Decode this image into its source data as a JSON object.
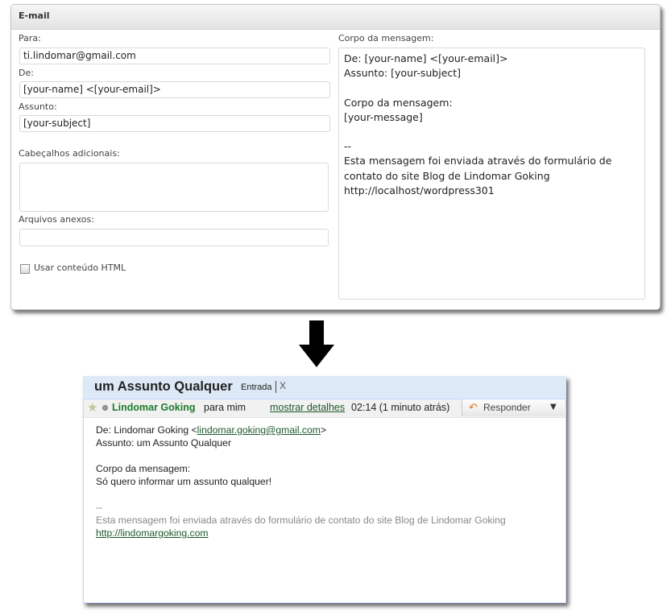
{
  "form": {
    "title": "E-mail",
    "to_label": "Para:",
    "to_value": "ti.lindomar@gmail.com",
    "from_label": "De:",
    "from_value": "[your-name] <[your-email]>",
    "subject_label": "Assunto:",
    "subject_value": "[your-subject]",
    "headers_label": "Cabeçalhos adicionais:",
    "attachments_label": "Arquivos anexos:",
    "html_label": "Usar conteúdo HTML",
    "body_label": "Corpo da mensagem:",
    "body_lines": [
      "De: [your-name] <[your-email]>",
      "Assunto: [your-subject]",
      "",
      "Corpo da mensagem:",
      "[your-message]",
      "",
      "--",
      "Esta mensagem foi enviada através do formulário de",
      "contato do site Blog de Lindomar Goking",
      "http://localhost/wordpress301"
    ]
  },
  "email": {
    "subject": "um Assunto Qualquer",
    "label": "Entrada",
    "remove": "X",
    "sender": "Lindomar Goking",
    "to_me": "para mim",
    "details_link": "mostrar detalhes",
    "time": "02:14 (1 minuto atrás)",
    "reply_label": "Responder",
    "from_prefix": "De: Lindomar Goking <",
    "from_email": "lindomar.goking@gmail.com",
    "from_suffix": ">",
    "subject_line": "Assunto: um Assunto Qualquer",
    "body_heading": "Corpo da mensagem:",
    "body_text": "Só quero informar um assunto qualquer!",
    "sig_sep": "--",
    "sig_text": "Esta mensagem foi enviada através do formulário de contato do site Blog de Lindomar Goking",
    "sig_link": "http://lindomargoking.com"
  },
  "colors": {
    "sender_green": "#1e7a2b",
    "header_blue": "#dde9f6",
    "link_green": "#1e5a2b"
  }
}
